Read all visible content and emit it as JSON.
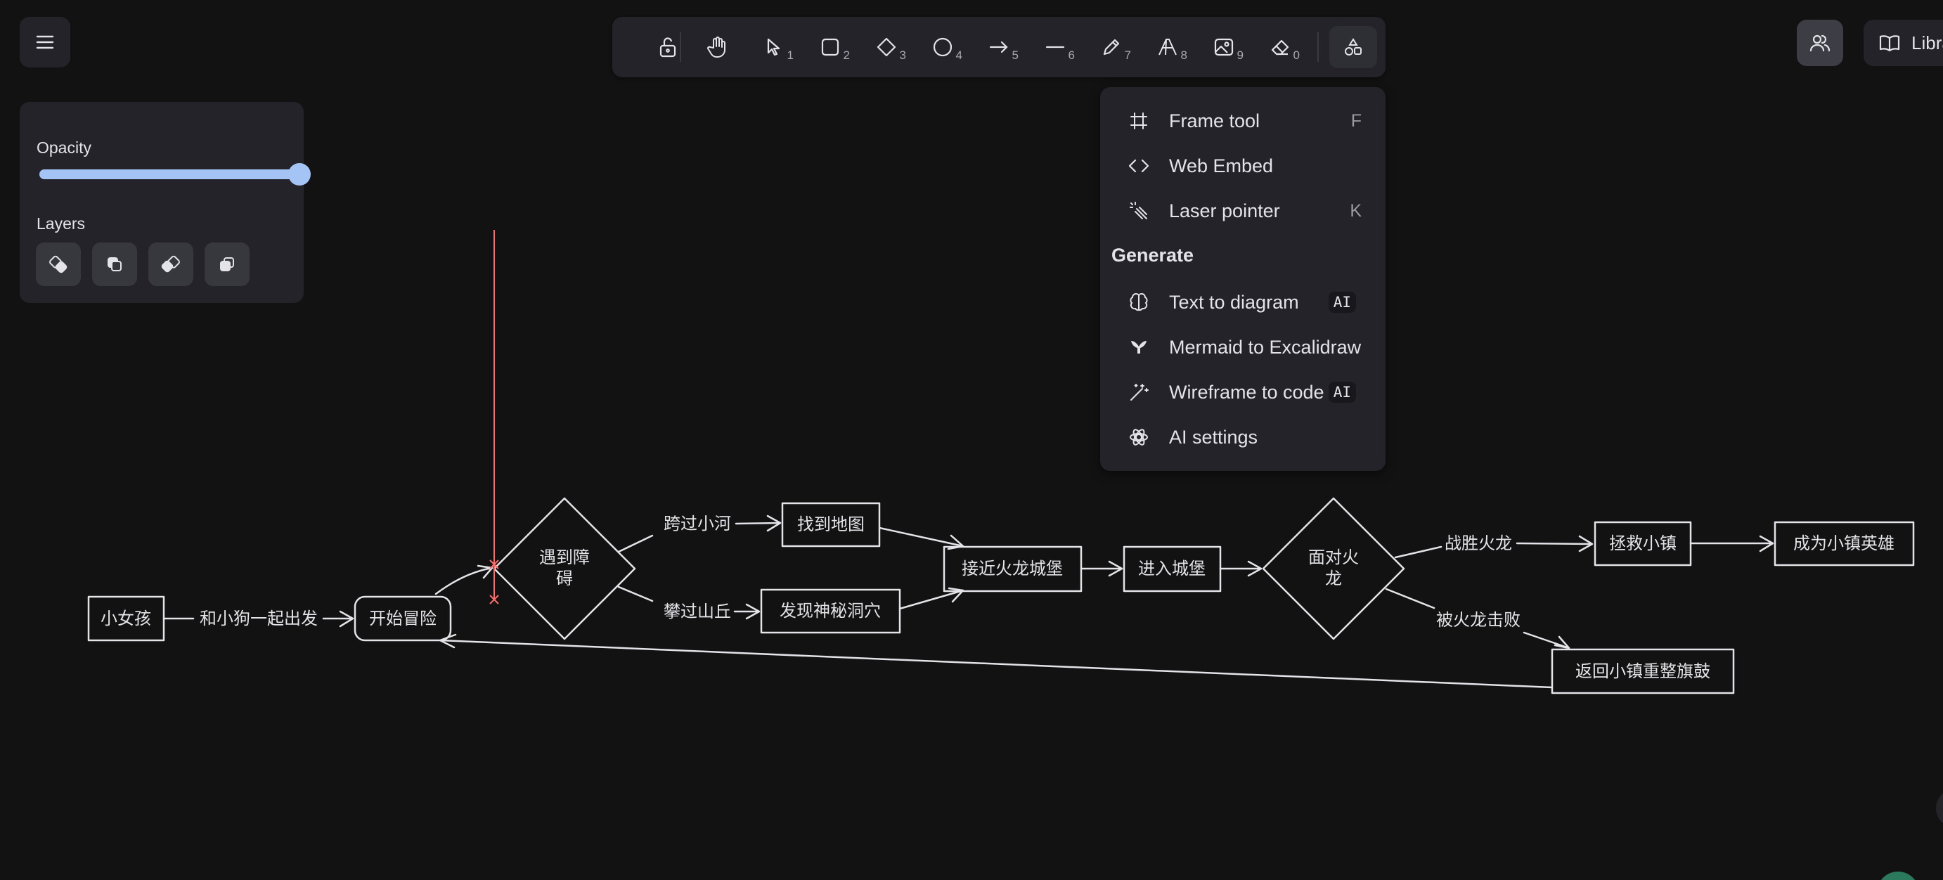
{
  "toolbar": {
    "tools": [
      {
        "name": "lock",
        "key": ""
      },
      {
        "name": "hand",
        "key": ""
      },
      {
        "name": "selection",
        "key": "1"
      },
      {
        "name": "rectangle",
        "key": "2"
      },
      {
        "name": "diamond",
        "key": "3"
      },
      {
        "name": "ellipse",
        "key": "4"
      },
      {
        "name": "arrow",
        "key": "5"
      },
      {
        "name": "line",
        "key": "6"
      },
      {
        "name": "draw",
        "key": "7"
      },
      {
        "name": "text",
        "key": "8"
      },
      {
        "name": "image",
        "key": "9"
      },
      {
        "name": "eraser",
        "key": "0"
      },
      {
        "name": "more-tools",
        "key": ""
      }
    ]
  },
  "topright": {
    "library_label": "Libra"
  },
  "props": {
    "opacity_label": "Opacity",
    "opacity_value": 100,
    "layers_label": "Layers"
  },
  "menu": {
    "frame_tool": {
      "label": "Frame tool",
      "shortcut": "F"
    },
    "web_embed": {
      "label": "Web Embed"
    },
    "laser": {
      "label": "Laser pointer",
      "shortcut": "K"
    },
    "generate_heading": "Generate",
    "text_to_diagram": {
      "label": "Text to diagram",
      "badge": "AI"
    },
    "mermaid": {
      "label": "Mermaid to Excalidraw"
    },
    "wireframe": {
      "label": "Wireframe to code",
      "badge": "AI"
    },
    "ai_settings": {
      "label": "AI settings"
    }
  },
  "diagram": {
    "girl": "小女孩",
    "with_dog": "和小狗一起出发",
    "start": "开始冒险",
    "obstacle_1": "遇到障",
    "obstacle_2": "碍",
    "cross_river": "跨过小河",
    "climb_hill": "攀过山丘",
    "find_map": "找到地图",
    "find_cave": "发现神秘洞穴",
    "approach_castle": "接近火龙城堡",
    "enter_castle": "进入城堡",
    "face_dragon_1": "面对火",
    "face_dragon_2": "龙",
    "defeat_dragon": "战胜火龙",
    "save_town": "拯救小镇",
    "become_hero": "成为小镇英雄",
    "defeated": "被火龙击败",
    "return_town": "返回小镇重整旗鼓"
  },
  "colors": {
    "accent": "#a4c4f5",
    "annotation": "#e03131",
    "selection_guide": "#ff6b6b"
  }
}
